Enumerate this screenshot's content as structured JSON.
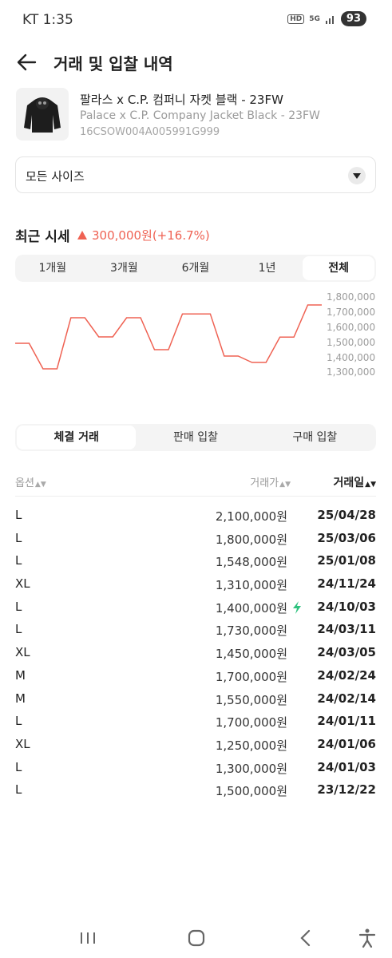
{
  "status": {
    "carrier_time": "KT 1:35",
    "hd": "HD",
    "network": "5G",
    "battery": "93"
  },
  "header": {
    "title": "거래 및 입찰 내역"
  },
  "product": {
    "name_ko": "팔라스 x C.P. 컴퍼니 자켓 블랙 - 23FW",
    "name_en": "Palace x C.P. Company Jacket Black - 23FW",
    "code": "16CSOW004A005991G999"
  },
  "size_select": {
    "value": "모든 사이즈"
  },
  "market": {
    "title": "최근 시세",
    "change": "300,000원(+16.7%)"
  },
  "period_tabs": [
    "1개월",
    "3개월",
    "6개월",
    "1년",
    "전체"
  ],
  "period_active": "전체",
  "chart_data": {
    "type": "line",
    "y_ticks": [
      "1,800,000",
      "1,700,000",
      "1,600,000",
      "1,500,000",
      "1,400,000",
      "1,300,000"
    ],
    "ylim": [
      1250000,
      1850000
    ],
    "series": [
      {
        "color": "#ef6253",
        "values": [
          1500000,
          1500000,
          1300000,
          1300000,
          1700000,
          1700000,
          1550000,
          1550000,
          1700000,
          1700000,
          1450000,
          1450000,
          1730000,
          1730000,
          1730000,
          1400000,
          1400000,
          1350000,
          1350000,
          1548000,
          1548000,
          1800000,
          1800000
        ]
      }
    ]
  },
  "tx_tabs": [
    "체결 거래",
    "판매 입찰",
    "구매 입찰"
  ],
  "tx_active": "체결 거래",
  "table": {
    "headers": {
      "option": "옵션",
      "price": "거래가",
      "date": "거래일"
    },
    "rows": [
      {
        "size": "L",
        "price": "2,100,000원",
        "date": "25/04/28",
        "bolt": false
      },
      {
        "size": "L",
        "price": "1,800,000원",
        "date": "25/03/06",
        "bolt": false
      },
      {
        "size": "L",
        "price": "1,548,000원",
        "date": "25/01/08",
        "bolt": false
      },
      {
        "size": "XL",
        "price": "1,310,000원",
        "date": "24/11/24",
        "bolt": false
      },
      {
        "size": "L",
        "price": "1,400,000원",
        "date": "24/10/03",
        "bolt": true
      },
      {
        "size": "L",
        "price": "1,730,000원",
        "date": "24/03/11",
        "bolt": false
      },
      {
        "size": "XL",
        "price": "1,450,000원",
        "date": "24/03/05",
        "bolt": false
      },
      {
        "size": "M",
        "price": "1,700,000원",
        "date": "24/02/24",
        "bolt": false
      },
      {
        "size": "M",
        "price": "1,550,000원",
        "date": "24/02/14",
        "bolt": false
      },
      {
        "size": "L",
        "price": "1,700,000원",
        "date": "24/01/11",
        "bolt": false
      },
      {
        "size": "XL",
        "price": "1,250,000원",
        "date": "24/01/06",
        "bolt": false
      },
      {
        "size": "L",
        "price": "1,300,000원",
        "date": "24/01/03",
        "bolt": false
      },
      {
        "size": "L",
        "price": "1,500,000원",
        "date": "23/12/22",
        "bolt": false
      }
    ]
  },
  "icons": {
    "back": "arrow-left-icon",
    "size_dropdown": "chevron-down-icon",
    "bolt": "lightning-icon",
    "nav": [
      "recent-apps-icon",
      "home-icon",
      "back-icon",
      "accessibility-icon"
    ]
  }
}
